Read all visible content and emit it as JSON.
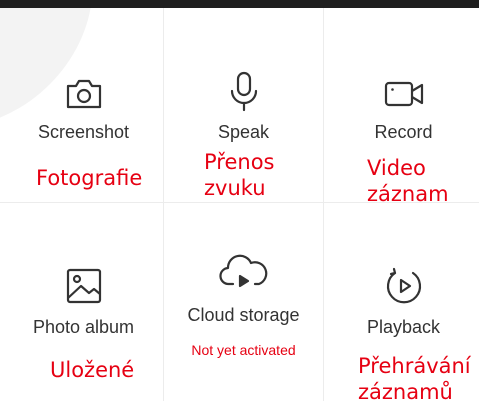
{
  "items": [
    {
      "label": "Screenshot",
      "annotation": "Fotografie",
      "icon": "camera-icon"
    },
    {
      "label": "Speak",
      "annotation": "Přenos zvuku",
      "annotation_lines": [
        "Přenos",
        "zvuku"
      ],
      "icon": "microphone-icon"
    },
    {
      "label": "Record",
      "annotation": "Video záznam",
      "annotation_lines": [
        "Video",
        "záznam"
      ],
      "icon": "video-camera-icon"
    },
    {
      "label": "Photo album",
      "annotation": "Uložené",
      "icon": "image-icon"
    },
    {
      "label": "Cloud storage",
      "status": "Not yet activated",
      "icon": "cloud-play-icon"
    },
    {
      "label": "Playback",
      "annotation": "Přehrávání záznamů",
      "annotation_lines": [
        "Přehrávání",
        "záznamů"
      ],
      "icon": "playback-icon"
    }
  ],
  "colors": {
    "annotation": "#e60012",
    "label": "#333333",
    "icon": "#333333"
  }
}
